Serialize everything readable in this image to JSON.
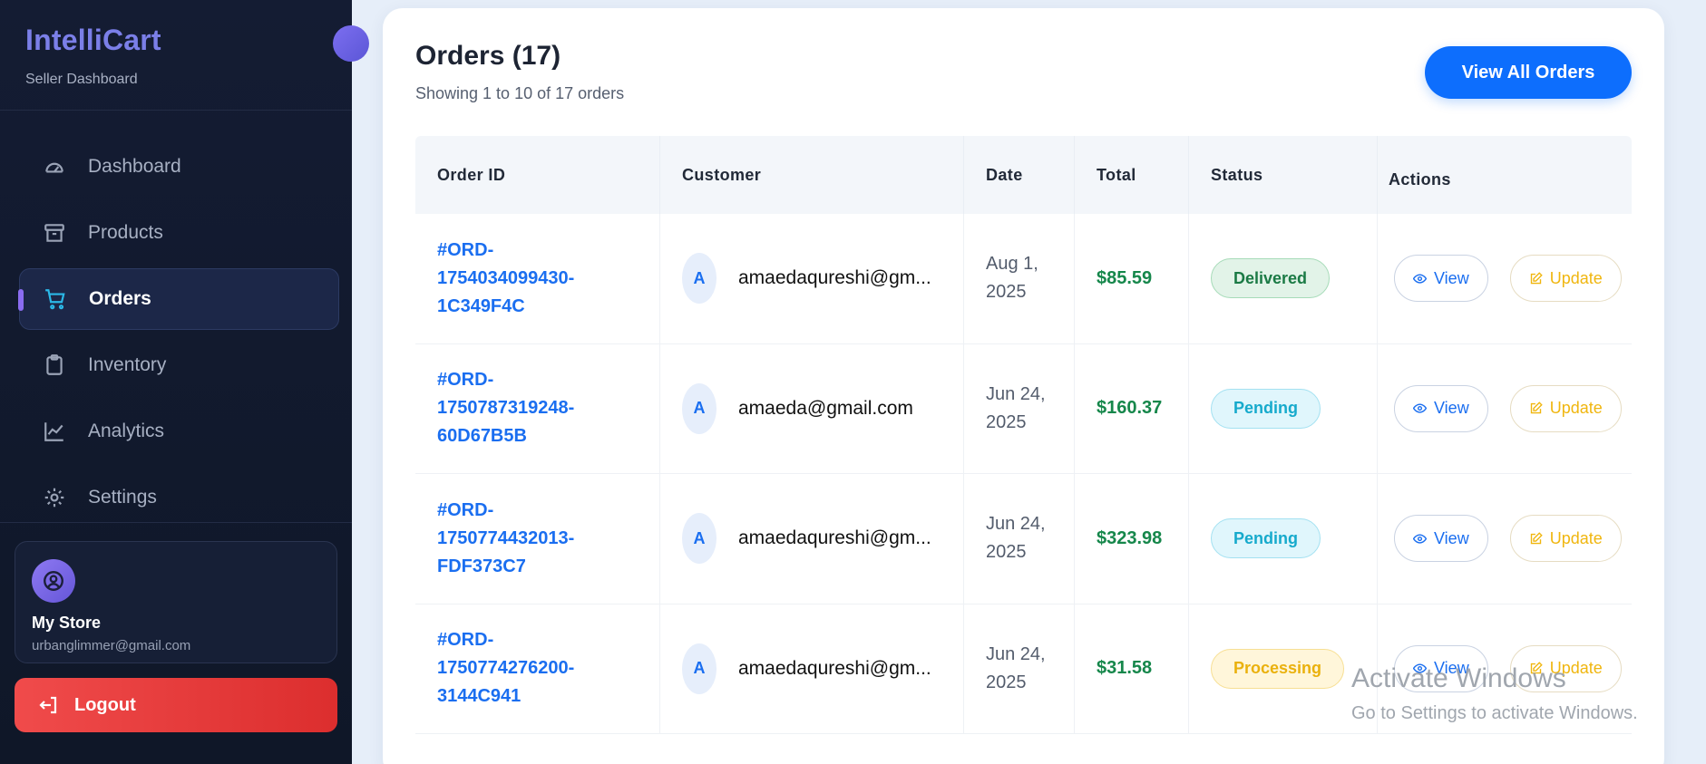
{
  "sidebar": {
    "brand": "IntelliCart",
    "subtitle": "Seller Dashboard",
    "items": [
      {
        "label": "Dashboard",
        "icon": "speedometer-icon"
      },
      {
        "label": "Products",
        "icon": "archive-box-icon"
      },
      {
        "label": "Orders",
        "icon": "cart-icon",
        "active": true
      },
      {
        "label": "Inventory",
        "icon": "clipboard-icon"
      },
      {
        "label": "Analytics",
        "icon": "line-chart-icon"
      },
      {
        "label": "Settings",
        "icon": "gear-icon"
      }
    ],
    "store": {
      "name": "My Store",
      "email": "urbanglimmer@gmail.com",
      "icon": "user-circle-icon"
    },
    "logout_label": "Logout"
  },
  "orders": {
    "title": "Orders (17)",
    "subtitle": "Showing 1 to 10 of 17 orders",
    "view_all_label": "View All Orders",
    "columns": [
      "Order ID",
      "Customer",
      "Date",
      "Total",
      "Status",
      "Actions"
    ],
    "rows": [
      {
        "id_lines": [
          "#ORD-",
          "1754034099430-",
          "1C349F4C"
        ],
        "avatar": "A",
        "email": "amaedaqureshi@gm...",
        "date_lines": [
          "Aug 1,",
          "2025"
        ],
        "total": "$85.59",
        "status": "Delivered"
      },
      {
        "id_lines": [
          "#ORD-",
          "1750787319248-",
          "60D67B5B"
        ],
        "avatar": "A",
        "email": "amaeda@gmail.com",
        "date_lines": [
          "Jun 24,",
          "2025"
        ],
        "total": "$160.37",
        "status": "Pending"
      },
      {
        "id_lines": [
          "#ORD-",
          "1750774432013-",
          "FDF373C7"
        ],
        "avatar": "A",
        "email": "amaedaqureshi@gm...",
        "date_lines": [
          "Jun 24,",
          "2025"
        ],
        "total": "$323.98",
        "status": "Pending"
      },
      {
        "id_lines": [
          "#ORD-",
          "1750774276200-",
          "3144C941"
        ],
        "avatar": "A",
        "email": "amaedaqureshi@gm...",
        "date_lines": [
          "Jun 24,",
          "2025"
        ],
        "total": "$31.58",
        "status": "Processing"
      }
    ],
    "view_label": "View",
    "update_label": "Update"
  },
  "watermark": {
    "title": "Activate Windows",
    "subtitle": "Go to Settings to activate Windows."
  },
  "colors": {
    "primary": "#0d6efd",
    "sidebar_bg": "#141c33",
    "logout": "#ef4444",
    "delivered": "#1b7a45",
    "pending": "#16aacc",
    "processing": "#eab10d",
    "total_green": "#16874b"
  }
}
